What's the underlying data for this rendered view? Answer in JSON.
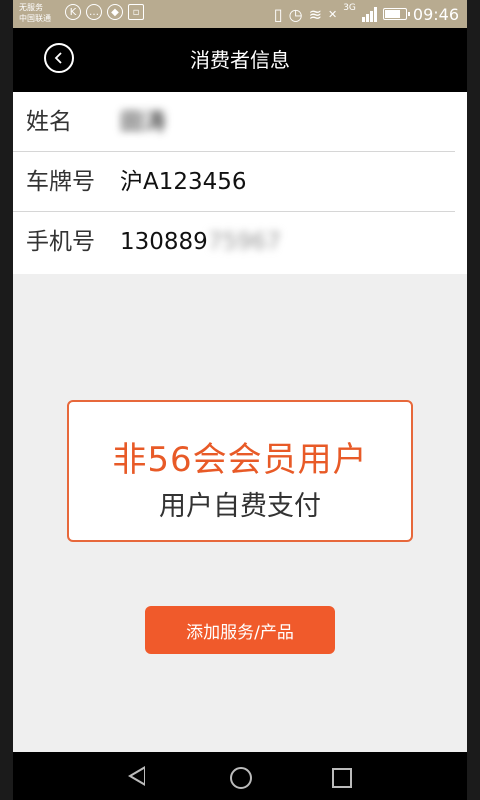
{
  "status_bar": {
    "carrier_line1": "无服务",
    "carrier_line2": "中国联通",
    "icon_k": "K",
    "network": "3G",
    "time": "09:46"
  },
  "header": {
    "title": "消费者信息"
  },
  "consumer": {
    "name_label": "姓名",
    "name_value": "田涛",
    "plate_label": "车牌号",
    "plate_value": "沪A123456",
    "phone_label": "手机号",
    "phone_visible": "130889",
    "phone_hidden": "75967"
  },
  "notice": {
    "line1": "非56会会员用户",
    "line2": "用户自费支付"
  },
  "actions": {
    "add_label": "添加服务/产品"
  },
  "colors": {
    "accent": "#f05a2b",
    "titlebar": "#000000",
    "statusbar": "#b8ab90"
  }
}
